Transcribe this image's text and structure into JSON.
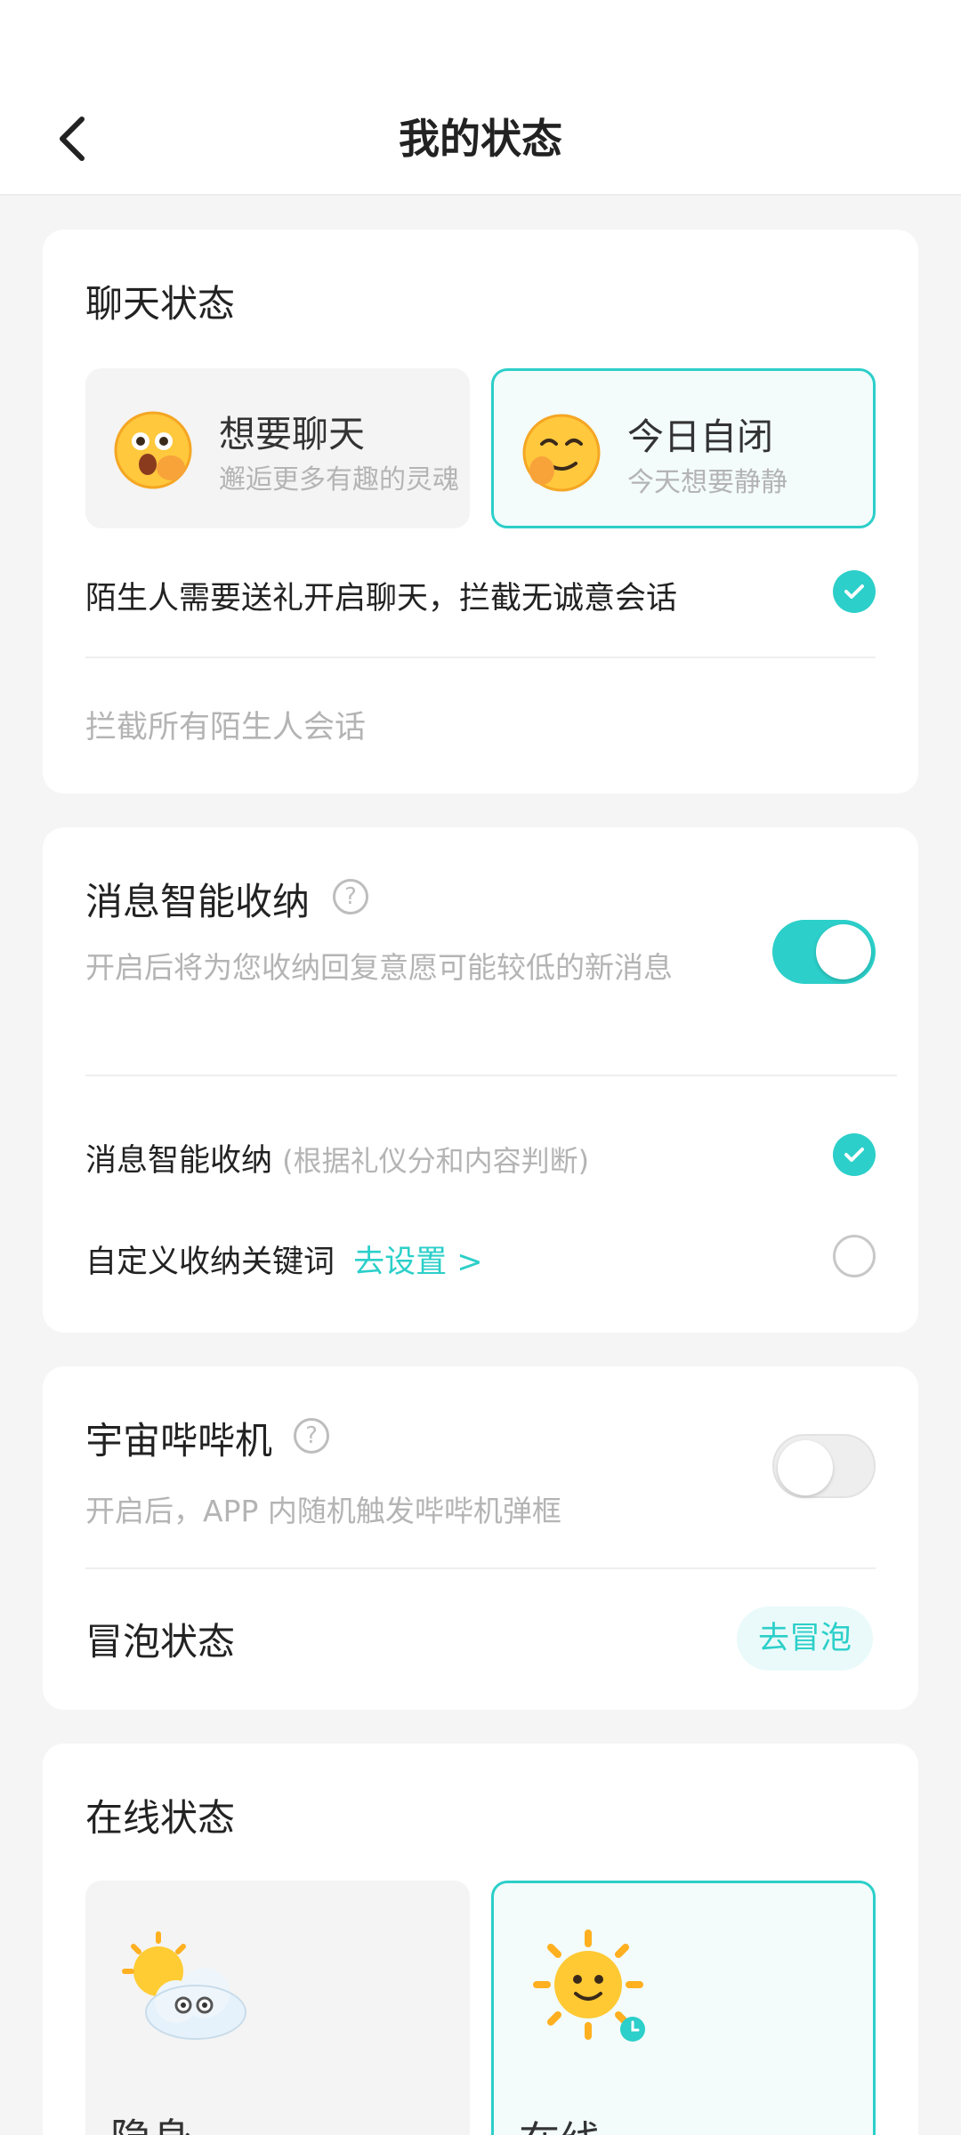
{
  "header": {
    "title": "我的状态"
  },
  "chat": {
    "title": "聊天状态",
    "options": [
      {
        "title": "想要聊天",
        "subtitle": "邂逅更多有趣的灵魂",
        "selected": false
      },
      {
        "title": "今日自闭",
        "subtitle": "今天想要静静",
        "selected": true
      }
    ],
    "gift_option": "陌生人需要送礼开启聊天，拦截无诚意会话",
    "block_all": "拦截所有陌生人会话"
  },
  "smart": {
    "title": "消息智能收纳",
    "desc": "开启后将为您收纳回复意愿可能较低的新消息",
    "toggle_on": true,
    "item1_label": "消息智能收纳",
    "item1_hint": "(根据礼仪分和内容判断)",
    "item2_label": "自定义收纳关键词",
    "item2_link": "去设置 >"
  },
  "beep": {
    "title": "宇宙哔哔机",
    "desc": "开启后，APP 内随机触发哔哔机弹框",
    "toggle_on": false,
    "bubble_title": "冒泡状态",
    "bubble_button": "去冒泡"
  },
  "online": {
    "title": "在线状态",
    "options": [
      {
        "title": "隐身",
        "selected": false
      },
      {
        "title": "在线",
        "selected": true
      }
    ]
  },
  "colors": {
    "accent": "#2ccfc9",
    "muted": "#b4b4b4"
  }
}
